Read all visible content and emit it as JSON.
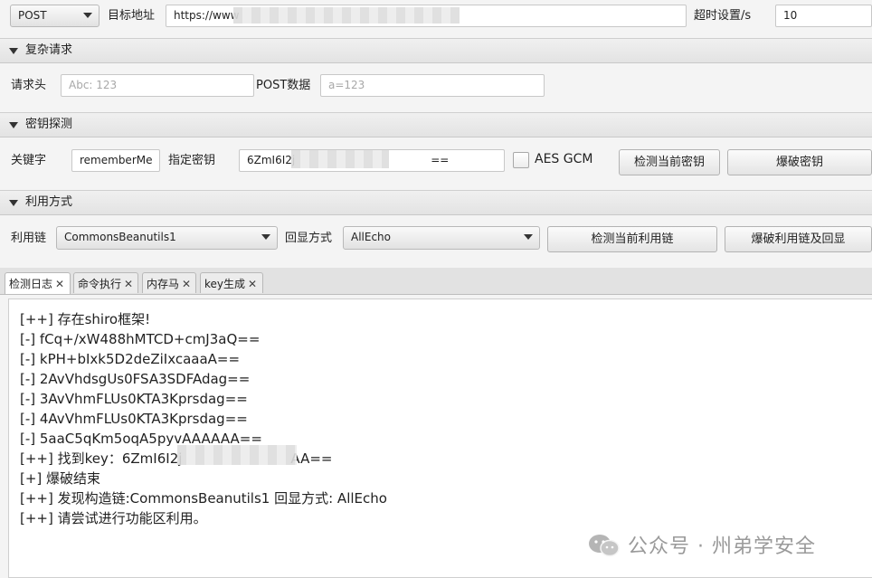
{
  "top": {
    "method": "POST",
    "target_label": "目标地址",
    "target_value": "https://www",
    "timeout_label": "超时设置/s",
    "timeout_value": "10"
  },
  "complex_request": {
    "title": "复杂请求",
    "header_label": "请求头",
    "header_placeholder": "Abc: 123",
    "post_label": "POST数据",
    "post_placeholder": "a=123"
  },
  "key_detect": {
    "title": "密钥探测",
    "keyword_label": "关键字",
    "keyword_value": "rememberMe",
    "key_label": "指定密钥",
    "key_value_prefix": "6ZmI6I2j",
    "key_value_suffix": "==",
    "gcm_label": "AES GCM",
    "detect_button": "检测当前密钥",
    "brute_button": "爆破密钥"
  },
  "exploit": {
    "title": "利用方式",
    "chain_label": "利用链",
    "chain_value": "CommonsBeanutils1",
    "echo_label": "回显方式",
    "echo_value": "AllEcho",
    "detect_chain_button": "检测当前利用链",
    "brute_chain_button": "爆破利用链及回显"
  },
  "tabs": [
    {
      "label": "检测日志",
      "close": "✕"
    },
    {
      "label": "命令执行",
      "close": "✕"
    },
    {
      "label": "内存马",
      "close": "✕"
    },
    {
      "label": "key生成",
      "close": "✕"
    }
  ],
  "log": [
    "[++] 存在shiro框架!",
    "[-] fCq+/xW488hMTCD+cmJ3aQ==",
    "[-] kPH+bIxk5D2deZiIxcaaaA==",
    "[-] 2AvVhdsgUs0FSA3SDFAdag==",
    "[-] 3AvVhmFLUs0KTA3Kprsdag==",
    "[-] 4AvVhmFLUs0KTA3Kprsdag==",
    "[-] 5aaC5qKm5oqA5pyvAAAAAA==",
    "[++] 找到key：6ZmI6I2j",
    "[+] 爆破结束",
    "[++] 发现构造链:CommonsBeanutils1  回显方式: AllEcho",
    "[++] 请尝试进行功能区利用。"
  ],
  "log_key_suffix": "AA==",
  "watermark": "公众号 · 州弟学安全"
}
